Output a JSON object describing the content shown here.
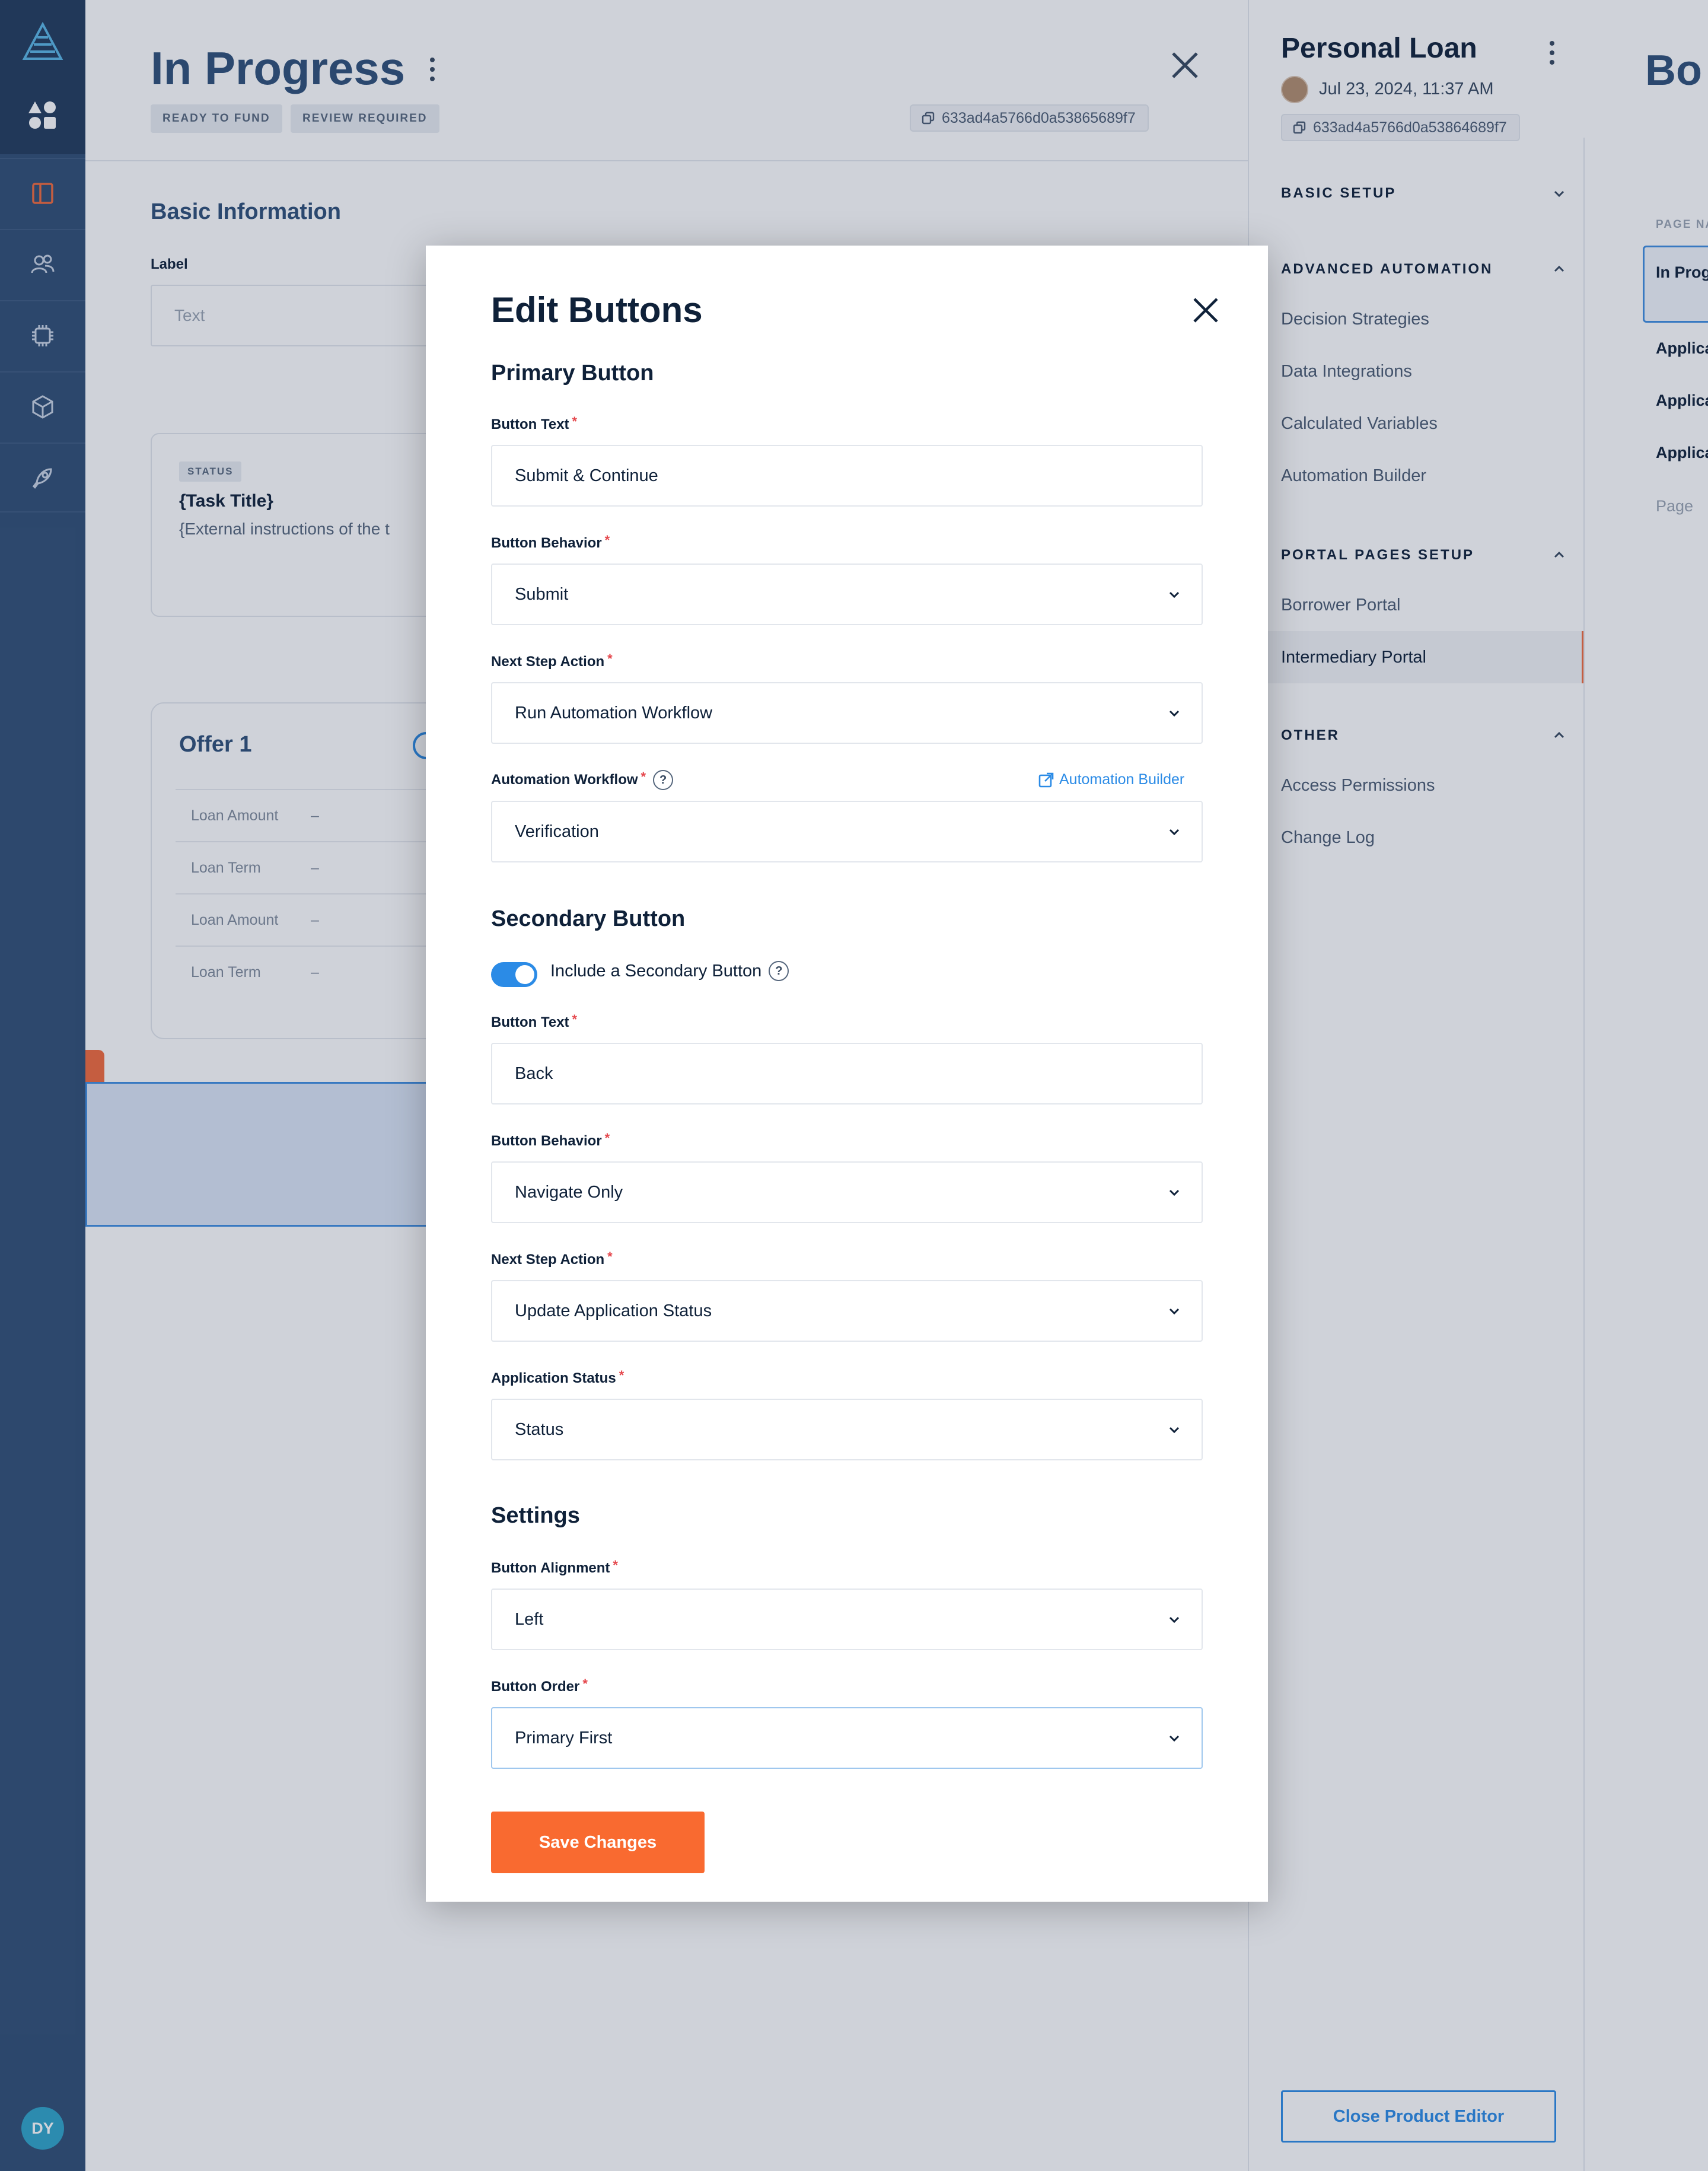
{
  "nav": {
    "avatar_initials": "DY"
  },
  "main": {
    "title": "In Progress",
    "tags": [
      "READY TO FUND",
      "REVIEW REQUIRED"
    ],
    "page_id": "633ad4a5766d0a53865689f7",
    "section_title": "Basic Information",
    "label_field": {
      "label": "Label",
      "placeholder": "Text"
    },
    "task_card": {
      "status": "STATUS",
      "title": "{Task Title}",
      "instructions": "{External instructions of the t"
    },
    "offer_card": {
      "title": "Offer 1",
      "rows": [
        {
          "key": "Loan Amount",
          "value": "–"
        },
        {
          "key": "Loan Term",
          "value": "–"
        },
        {
          "key": "Loan Amount",
          "value": "–"
        },
        {
          "key": "Loan Term",
          "value": "–"
        }
      ]
    }
  },
  "panel": {
    "title": "Personal Loan",
    "date": "Jul 23, 2024, 11:37 AM",
    "product_id": "633ad4a5766d0a53864689f7",
    "sections": {
      "basic_setup": "BASIC SETUP",
      "advanced_automation": "ADVANCED AUTOMATION",
      "advanced_items": [
        "Decision Strategies",
        "Data Integrations",
        "Calculated Variables",
        "Automation Builder"
      ],
      "portal_pages_setup": "PORTAL PAGES SETUP",
      "portal_items": [
        "Borrower Portal",
        "Intermediary Portal"
      ],
      "other": "OTHER",
      "other_items": [
        "Access Permissions",
        "Change Log"
      ]
    },
    "close_editor": "Close Product Editor"
  },
  "preview": {
    "title": "Bo",
    "page_label": "PAGE NA",
    "active_item": "In Prog",
    "items": [
      "Applica",
      "Applica",
      "Applica"
    ],
    "last_item": "Page"
  },
  "modal": {
    "title": "Edit Buttons",
    "primary": {
      "heading": "Primary Button",
      "button_text_label": "Button Text",
      "button_text_value": "Submit & Continue",
      "behavior_label": "Button Behavior",
      "behavior_value": "Submit",
      "next_step_label": "Next Step Action",
      "next_step_value": "Run Automation Workflow",
      "workflow_label": "Automation Workflow",
      "workflow_link": "Automation Builder",
      "workflow_value": "Verification"
    },
    "secondary": {
      "heading": "Secondary Button",
      "toggle_label": "Include a Secondary Button",
      "toggle_on": true,
      "button_text_label": "Button Text",
      "button_text_value": "Back",
      "behavior_label": "Button Behavior",
      "behavior_value": "Navigate Only",
      "next_step_label": "Next Step Action",
      "next_step_value": "Update Application Status",
      "status_label": "Application Status",
      "status_value": "Status"
    },
    "settings": {
      "heading": "Settings",
      "alignment_label": "Button Alignment",
      "alignment_value": "Left",
      "order_label": "Button Order",
      "order_value": "Primary First"
    },
    "required_mark": "*",
    "help_mark": "?",
    "save_label": "Save Changes"
  },
  "colors": {
    "nav_bg": "#2f4d74",
    "accent_blue": "#2b8be6",
    "save_orange": "#f96a30",
    "required_red": "#e5484d"
  },
  "icons": [
    "logo-icon",
    "shapes-icon",
    "book-icon",
    "users-icon",
    "chip-icon",
    "cube-icon",
    "rocket-icon",
    "kebab-icon",
    "close-icon",
    "copy-icon",
    "chevron-down-icon",
    "chevron-up-icon",
    "external-link-icon",
    "help-icon"
  ]
}
